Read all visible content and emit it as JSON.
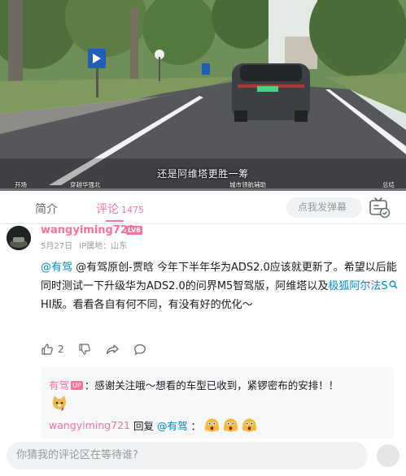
{
  "video": {
    "subtitle": "还是阿维塔更胜一筹",
    "chapters": [
      "开场",
      "穿越华强北",
      "城市领航辅助",
      "总结"
    ],
    "colors": {
      "sky": "#dfe6e2",
      "road": "#56575b",
      "grass": "#7f9a5c",
      "car": "#3c4045"
    }
  },
  "tabs": {
    "intro": "简介",
    "comments": "评论",
    "comments_count": "1475",
    "danmaku_placeholder": "点我发弹幕",
    "accent_color": "#fb7299"
  },
  "comment": {
    "username": "wangyiming721",
    "level": "LV6",
    "date": "5月27日",
    "location": "IP属地：山东",
    "mention1": "@有驾",
    "text1": " @有驾原创-贾晗  今年下半年华为ADS2.0应该就更新了。希望以后能同时测试一下升级华为ADS2.0的问界M5智驾版，阿维塔以及",
    "keyword": "极狐阿尔法S",
    "text2": " HI版。看看各自有何不同，有没有好的优化～",
    "likes": "2"
  },
  "replies": {
    "r1_user": "有驾",
    "r1_badge": "UP",
    "r1_text": "：感谢关注哦～想看的车型已收到，紧锣密布的安排！！",
    "r2_user": "wangyiming721",
    "r2_verb": "回复",
    "r2_mention": "@有驾",
    "r2_sep": "："
  },
  "bottom": {
    "input_placeholder": "你猜我的评论区在等待谁?"
  }
}
